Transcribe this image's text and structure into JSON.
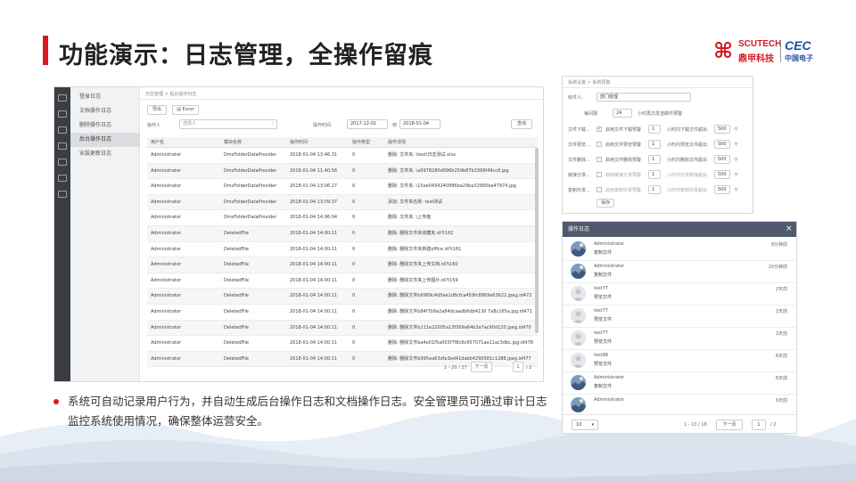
{
  "slide": {
    "title": "功能演示：日志管理，全操作留痕",
    "description": "系统可自动记录用户行为，并自动生成后台操作日志和文档操作日志。安全管理员可通过审计日志监控系统使用情况，确保整体运营安全。",
    "accent_color": "#d71920"
  },
  "logo": {
    "brand_en": "SCUTECH",
    "brand_cn": "鼎甲科技",
    "partner_en": "CEC",
    "partner_cn": "中国电子",
    "brand_icon": "scutech-mark-icon"
  },
  "main_screen": {
    "breadcrumb": "日志管理 > 后台操作日志",
    "menu": [
      {
        "label": "登录日志",
        "active": false
      },
      {
        "label": "文档操作日志",
        "active": false
      },
      {
        "label": "删除操作日志",
        "active": false
      },
      {
        "label": "后台操作日志",
        "active": true
      },
      {
        "label": "安装更新日志",
        "active": false
      }
    ],
    "toolbar": {
      "export_label": "导出",
      "excel_label": "Excel"
    },
    "filters": {
      "operator_label": "操作人",
      "operator_placeholder": "选择人",
      "time_label": "操作时间",
      "date_from": "2017-12-01",
      "to_label": "到",
      "date_to": "2018-01-04",
      "search_label": "查询"
    },
    "columns": [
      "用户名",
      "模块名称",
      "操作时间",
      "操作类型",
      "操作详情"
    ],
    "rows": [
      [
        "Administrator",
        "DmsFolderDataProvider",
        "2018-01-04 13:46:31",
        "0",
        "删除: 文件夹: \\test\\日志测试.xlsx"
      ],
      [
        "Administrator",
        "DmsFolderDataProvider",
        "2018-01-04 11:40:56",
        "0",
        "删除: 文件夹: \\a9978280d996b259b87b3368f49cc8.jpg"
      ],
      [
        "Administrator",
        "DmsFolderDataProvider",
        "2018-01-04 13:06:27",
        "0",
        "删除: 文件夹: \\15ee0454240986ba29be32995be47974.jpg"
      ],
      [
        "Administrator",
        "DmsFolderDataProvider",
        "2018-01-04 13:09:37",
        "0",
        "添加: 文件夹名称: test测试"
      ],
      [
        "Administrator",
        "DmsFolderDataProvider",
        "2018-01-04 14:06:04",
        "0",
        "删除: 文件夹: \\上传盘"
      ],
      [
        "Administrator",
        "DeletedFile",
        "2018-01-04 14:00:11",
        "0",
        "删除: 删除文件夹收藏夹.id?t162"
      ],
      [
        "Administrator",
        "DeletedFile",
        "2018-01-04 14:00:11",
        "0",
        "删除: 删除文件夹新建office.id?t161"
      ],
      [
        "Administrator",
        "DeletedFile",
        "2018-01-04 14:00:11",
        "0",
        "删除: 删除文件夹上传文档.id?t160"
      ],
      [
        "Administrator",
        "DeletedFile",
        "2018-01-04 14:00:11",
        "0",
        "删除: 删除文件夹上传图片.id?t159"
      ],
      [
        "Administrator",
        "DeletedFile",
        "2018-01-04 14:00:11",
        "0",
        "删除: 删除文件b6989c4d5ee1d8cfca459fc8869a63622.jpeg.id472"
      ],
      [
        "Administrator",
        "DeletedFile",
        "2018-01-04 14:00:11",
        "0",
        "删除: 删除文件b84f7b9a2a84dcaadb6db4130 7a8c165a.jpg.id471"
      ],
      [
        "Administrator",
        "DeletedFile",
        "2018-01-04 14:00:11",
        "0",
        "删除: 删除文件b111e22005a13f309a64b3a7ac90d120.jpeg.id470"
      ],
      [
        "Administrator",
        "DeletedFile",
        "2018-01-04 14:00:11",
        "0",
        "删除: 删除文件ba4e01f5a003f7f8c6c957071aa11ac3dbc.jpg.id478"
      ],
      [
        "Administrator",
        "DeletedFile",
        "2018-01-04 14:00:11",
        "0",
        "删除: 删除文件b995ea63dfa3ed41dabb4290581c1288.jpeg.id477"
      ]
    ],
    "pager": {
      "range": "1 - 20 / 27",
      "next_label": "下一页",
      "page": "1",
      "total": "/ 2"
    }
  },
  "settings_screen": {
    "breadcrumb": "系统设置 > 系统预警",
    "receiver_label": "收件人:",
    "receiver_value": "部门经理",
    "cycle_label": "每间隔",
    "cycle_value": "24",
    "cycle_unit": "小时再次发送邮件预警",
    "rules": [
      {
        "label": "文件下载...",
        "checked": true,
        "text": "启用文件下载预警",
        "count": "1",
        "mid": "小时内下载文件超出",
        "limit": "500",
        "unit": "个",
        "dim": false
      },
      {
        "label": "文件预览...",
        "checked": false,
        "text": "启用文件预览预警",
        "count": "1",
        "mid": "小时内预览文件超出",
        "limit": "500",
        "unit": "个",
        "dim": false
      },
      {
        "label": "文件删除...",
        "checked": false,
        "text": "启用文件删除预警",
        "count": "1",
        "mid": "小时内删除文件超出",
        "limit": "500",
        "unit": "个",
        "dim": false
      },
      {
        "label": "链接分享...",
        "checked": false,
        "text": "启用链接分享预警",
        "count": "1",
        "mid": "小时内分享链接超出",
        "limit": "500",
        "unit": "个",
        "dim": true
      },
      {
        "label": "复制外发...",
        "checked": false,
        "text": "启用复制外发预警",
        "count": "1",
        "mid": "小时内复制外发超出",
        "limit": "500",
        "unit": "个",
        "dim": true
      }
    ],
    "save_label": "保存"
  },
  "log_panel": {
    "title": "操作日志",
    "close_icon": "close-icon",
    "items": [
      {
        "user": "Administrator",
        "action": "复制文件",
        "time": "8分钟前",
        "avatar": "photo"
      },
      {
        "user": "Administrator",
        "action": "复制文件",
        "time": "10分钟前",
        "avatar": "photo"
      },
      {
        "user": "test77",
        "action": "预览文件",
        "time": "2天前",
        "avatar": "default"
      },
      {
        "user": "test77",
        "action": "预览文件",
        "time": "2天前",
        "avatar": "default"
      },
      {
        "user": "test77",
        "action": "预览文件",
        "time": "2天前",
        "avatar": "default"
      },
      {
        "user": "test98",
        "action": "预览文件",
        "time": "6天前",
        "avatar": "default"
      },
      {
        "user": "Administrator",
        "action": "复制文件",
        "time": "6天前",
        "avatar": "photo"
      },
      {
        "user": "Administrator",
        "action": "",
        "time": "6天前",
        "avatar": "photo"
      }
    ],
    "page_size": "10",
    "range": "1 - 10 / 18",
    "next_label": "下一页",
    "page": "1",
    "total": "/ 2"
  }
}
